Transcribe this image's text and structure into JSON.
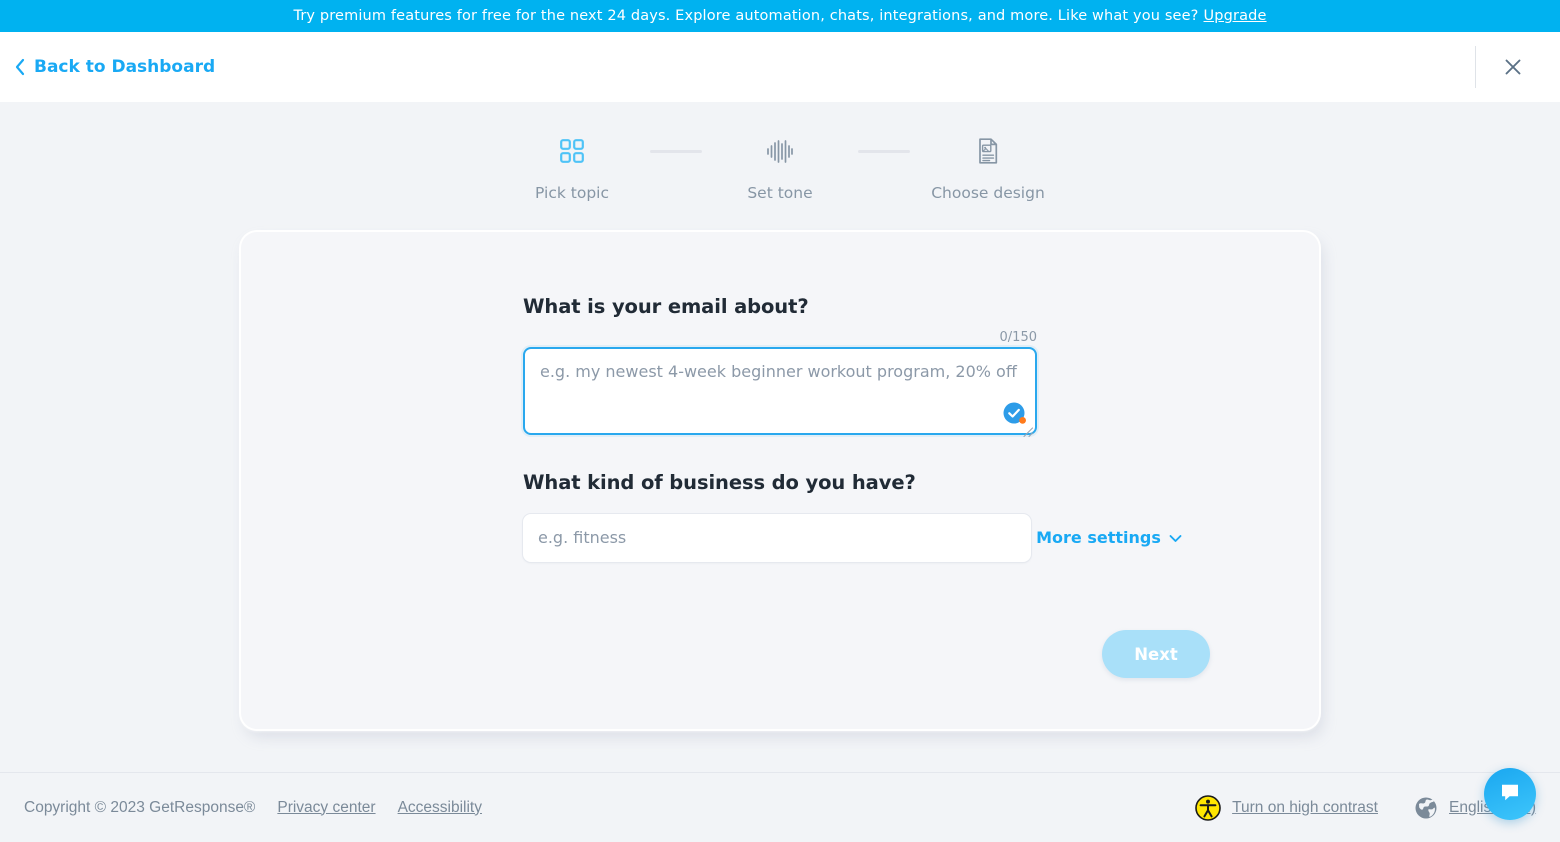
{
  "promo": {
    "text": "Try premium features for free for the next 24 days. Explore automation, chats, integrations, and more. Like what you see?",
    "upgrade_label": "Upgrade",
    "background": "#00b2f0"
  },
  "topbar": {
    "back_label": "Back to Dashboard",
    "back_icon": "chevron-left-icon",
    "close_icon": "close-icon",
    "accent": "#19a9f4"
  },
  "stepper": {
    "steps": [
      {
        "label": "Pick topic",
        "icon": "grid-squares-icon",
        "active": true
      },
      {
        "label": "Set tone",
        "icon": "waveform-icon",
        "active": false
      },
      {
        "label": "Choose design",
        "icon": "document-image-icon",
        "active": false
      }
    ],
    "active_color": "#4fc3f7",
    "inactive_color": "#8796a5"
  },
  "form": {
    "topic": {
      "label": "What is your email about?",
      "placeholder": "e.g. my newest 4-week beginner workout program, 20% off",
      "value": "",
      "counter": "0/150",
      "max_length": 150,
      "focused": true,
      "assistant_badge_icon": "grammarly-check-icon"
    },
    "business": {
      "label": "What kind of business do you have?",
      "placeholder": "e.g. fitness",
      "value": ""
    },
    "more_settings": {
      "label": "More settings",
      "icon": "chevron-down-icon",
      "expanded": false
    },
    "next_button": {
      "label": "Next",
      "disabled": true,
      "color": "#a9e0f9"
    }
  },
  "footer": {
    "copyright": "Copyright © 2023 GetResponse®",
    "links": [
      {
        "label": "Privacy center"
      },
      {
        "label": "Accessibility"
      }
    ],
    "high_contrast": {
      "label": "Turn on high contrast",
      "icon": "accessibility-icon"
    },
    "language": {
      "label": "English (EN)",
      "icon": "globe-icon"
    },
    "chat_icon": "chat-bubble-icon"
  }
}
